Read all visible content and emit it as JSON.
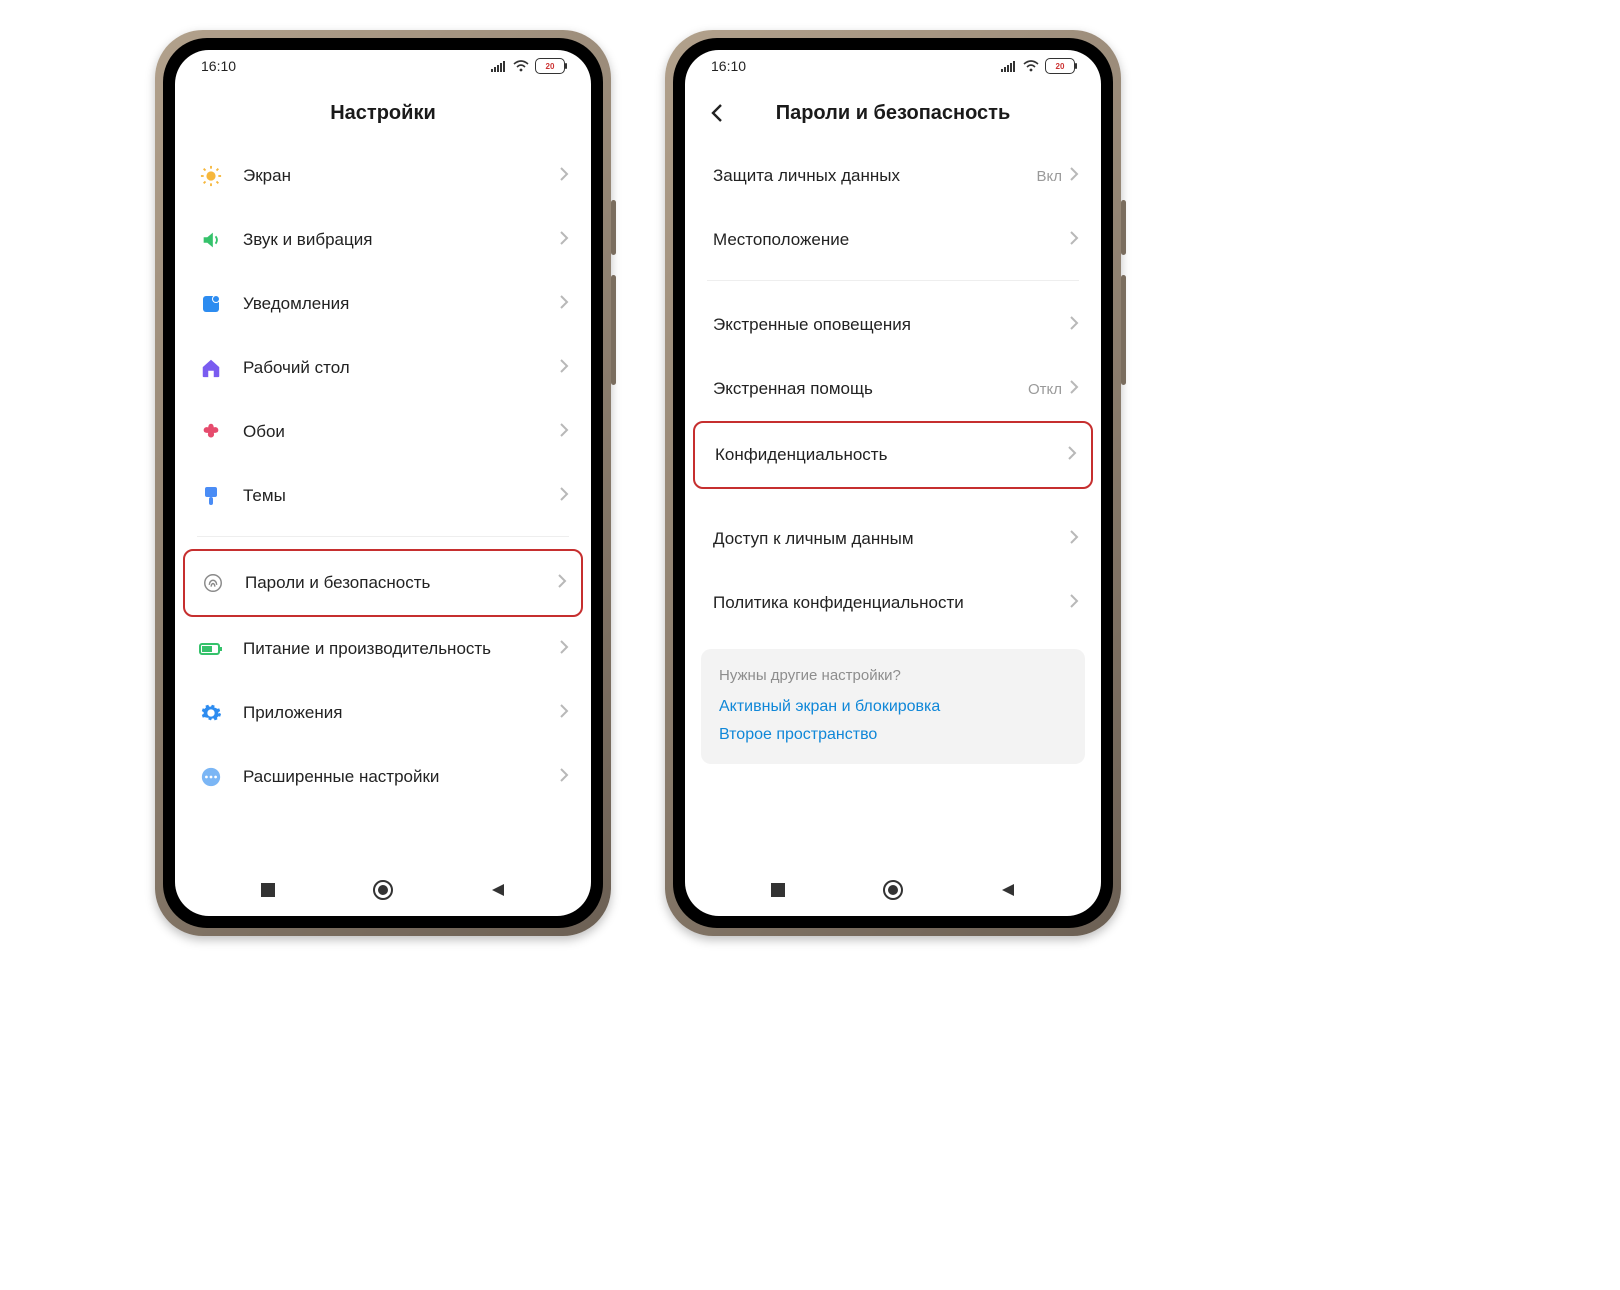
{
  "status": {
    "time": "16:10",
    "battery_text": "20"
  },
  "left": {
    "title": "Настройки",
    "items": [
      {
        "label": "Экран"
      },
      {
        "label": "Звук и вибрация"
      },
      {
        "label": "Уведомления"
      },
      {
        "label": "Рабочий стол"
      },
      {
        "label": "Обои"
      },
      {
        "label": "Темы"
      },
      {
        "label": "Пароли и безопасность"
      },
      {
        "label": "Питание и производительность"
      },
      {
        "label": "Приложения"
      },
      {
        "label": "Расширенные настройки"
      }
    ]
  },
  "right": {
    "title": "Пароли и безопасность",
    "items": [
      {
        "label": "Защита личных данных",
        "value": "Вкл"
      },
      {
        "label": "Местоположение"
      },
      {
        "label": "Экстренные оповещения"
      },
      {
        "label": "Экстренная помощь",
        "value": "Откл"
      },
      {
        "label": "Конфиденциальность"
      },
      {
        "label": "Доступ к личным данным"
      },
      {
        "label": "Политика конфиденциальности"
      }
    ],
    "card": {
      "question": "Нужны другие настройки?",
      "links": [
        "Активный экран и блокировка",
        "Второе пространство"
      ]
    }
  }
}
